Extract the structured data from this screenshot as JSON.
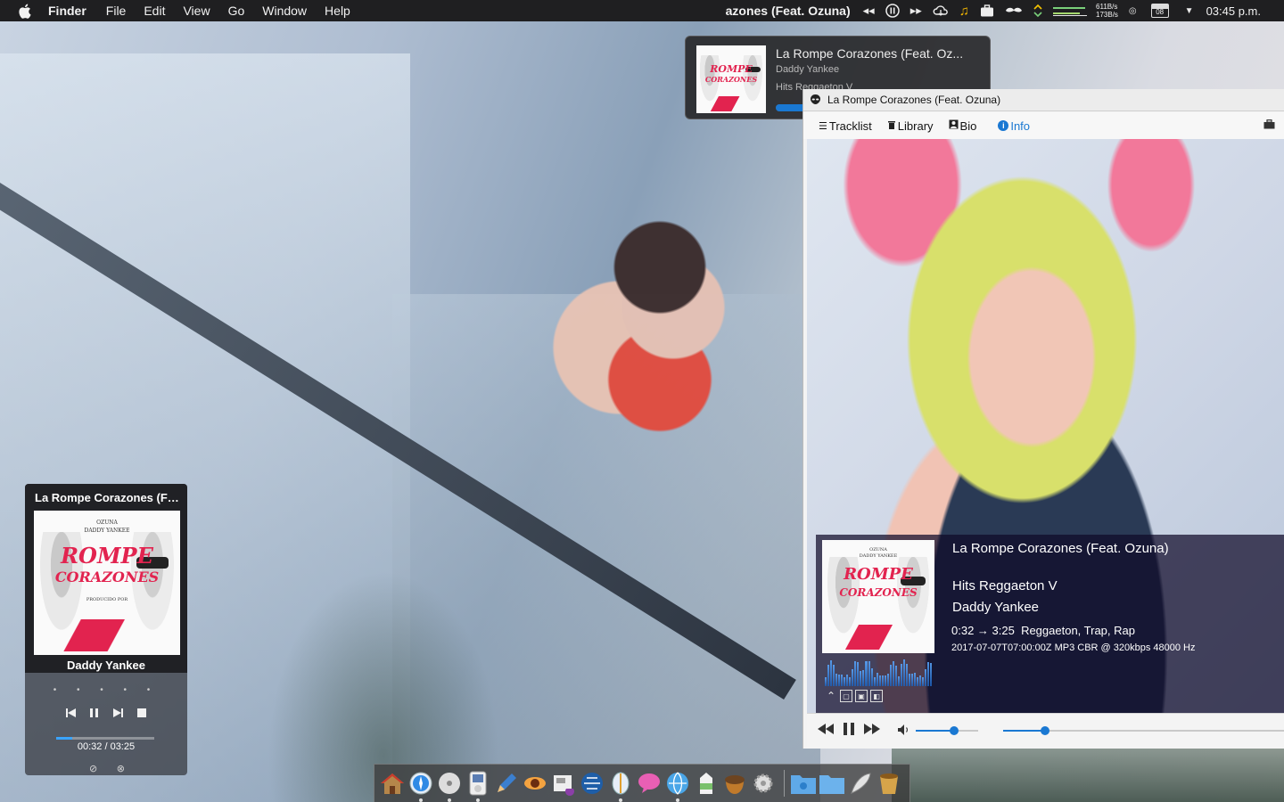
{
  "menubar": {
    "app_name": "Finder",
    "menus": [
      "File",
      "Edit",
      "View",
      "Go",
      "Window",
      "Help"
    ],
    "now_playing": "azones (Feat. Ozuna)",
    "net_up": "611B/s",
    "net_down": "173B/s",
    "calendar_day": "08",
    "clock": "03:45 p.m.",
    "icons": [
      "apple-icon",
      "rewind-icon",
      "pause-icon",
      "forward-icon",
      "cloud-icon",
      "music-note-icon",
      "briefcase-icon",
      "mustache-icon",
      "network-icon",
      "calendar-icon",
      "chevron-down-icon"
    ]
  },
  "notification": {
    "title": "La Rompe Corazones (Feat. Oz...",
    "artist": "Daddy Yankee",
    "album": "Hits Reggaeton V",
    "progress_fraction": 0.16
  },
  "widget": {
    "title": "La Rompe Corazones (Fe...",
    "artist": "Daddy Yankee",
    "dots": "• • • • •",
    "time": "00:32 / 03:25",
    "progress_fraction": 0.16
  },
  "cover_art": {
    "top_small": "OZUNA",
    "mid_small": "DADDY YANKEE",
    "word1": "ROMPE",
    "word2": "CORAZONES",
    "bottom_small": "PRODUCIDO POR"
  },
  "player": {
    "window_title": "La Rompe Corazones (Feat. Ozuna)",
    "tabs": [
      {
        "label": "Tracklist",
        "icon": "list-icon"
      },
      {
        "label": "Library",
        "icon": "trash-icon"
      },
      {
        "label": "Bio",
        "icon": "person-icon"
      },
      {
        "label": "Info",
        "icon": "info-icon",
        "active": true
      }
    ],
    "track_title": "La Rompe Corazones (Feat. Ozuna)",
    "album": "Hits Reggaeton V",
    "artist": "Daddy Yankee",
    "time": "0:32 → 3:25",
    "genres": "Reggaeton, Trap, Rap",
    "meta": "2017-07-07T07:00:00Z  MP3 CBR @ 320kbps 48000 Hz",
    "volume_fraction": 0.62,
    "seek_fraction": 0.15,
    "accent": "#1a78d2"
  },
  "dock": {
    "apps": [
      "home-icon",
      "safari-icon",
      "dvd-icon",
      "ipod-icon",
      "pencil-icon",
      "eye-icon",
      "news-icon",
      "globe-icon",
      "mail-icon",
      "chat-icon",
      "network-globe-icon",
      "milk-icon",
      "acorn-icon",
      "settings-icon",
      "folder-icon",
      "folder-icon",
      "feather-icon",
      "bucket-icon"
    ]
  }
}
